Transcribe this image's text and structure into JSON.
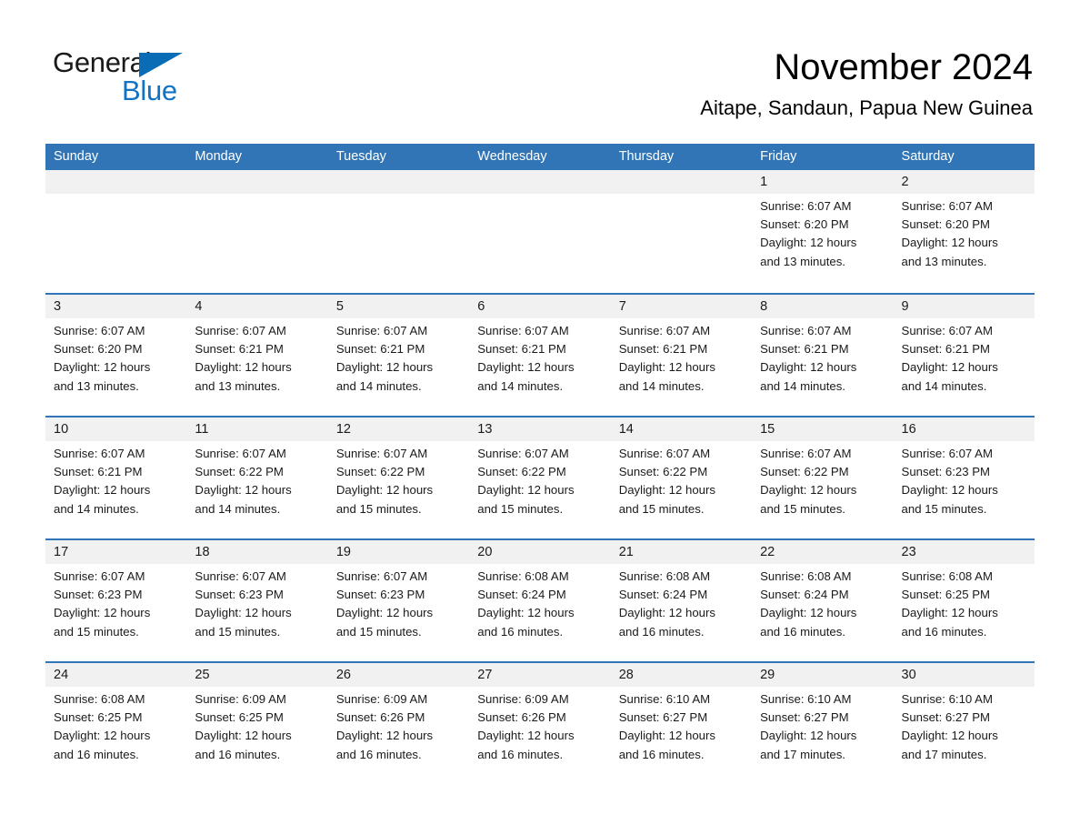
{
  "brand": {
    "word1": "General",
    "word2": "Blue",
    "triangle_color": "#0a6cb4",
    "blue_color": "#1273c4"
  },
  "header": {
    "title": "November 2024",
    "subtitle": "Aitape, Sandaun, Papua New Guinea"
  },
  "theme": {
    "header_blue": "#3275b6",
    "row_band_gray": "#f1f1f1",
    "text_color": "#1a1a1a"
  },
  "weekdays": [
    "Sunday",
    "Monday",
    "Tuesday",
    "Wednesday",
    "Thursday",
    "Friday",
    "Saturday"
  ],
  "weeks": [
    [
      {
        "day": "",
        "info": ""
      },
      {
        "day": "",
        "info": ""
      },
      {
        "day": "",
        "info": ""
      },
      {
        "day": "",
        "info": ""
      },
      {
        "day": "",
        "info": ""
      },
      {
        "day": "1",
        "info": "Sunrise: 6:07 AM\nSunset: 6:20 PM\nDaylight: 12 hours\nand 13 minutes."
      },
      {
        "day": "2",
        "info": "Sunrise: 6:07 AM\nSunset: 6:20 PM\nDaylight: 12 hours\nand 13 minutes."
      }
    ],
    [
      {
        "day": "3",
        "info": "Sunrise: 6:07 AM\nSunset: 6:20 PM\nDaylight: 12 hours\nand 13 minutes."
      },
      {
        "day": "4",
        "info": "Sunrise: 6:07 AM\nSunset: 6:21 PM\nDaylight: 12 hours\nand 13 minutes."
      },
      {
        "day": "5",
        "info": "Sunrise: 6:07 AM\nSunset: 6:21 PM\nDaylight: 12 hours\nand 14 minutes."
      },
      {
        "day": "6",
        "info": "Sunrise: 6:07 AM\nSunset: 6:21 PM\nDaylight: 12 hours\nand 14 minutes."
      },
      {
        "day": "7",
        "info": "Sunrise: 6:07 AM\nSunset: 6:21 PM\nDaylight: 12 hours\nand 14 minutes."
      },
      {
        "day": "8",
        "info": "Sunrise: 6:07 AM\nSunset: 6:21 PM\nDaylight: 12 hours\nand 14 minutes."
      },
      {
        "day": "9",
        "info": "Sunrise: 6:07 AM\nSunset: 6:21 PM\nDaylight: 12 hours\nand 14 minutes."
      }
    ],
    [
      {
        "day": "10",
        "info": "Sunrise: 6:07 AM\nSunset: 6:21 PM\nDaylight: 12 hours\nand 14 minutes."
      },
      {
        "day": "11",
        "info": "Sunrise: 6:07 AM\nSunset: 6:22 PM\nDaylight: 12 hours\nand 14 minutes."
      },
      {
        "day": "12",
        "info": "Sunrise: 6:07 AM\nSunset: 6:22 PM\nDaylight: 12 hours\nand 15 minutes."
      },
      {
        "day": "13",
        "info": "Sunrise: 6:07 AM\nSunset: 6:22 PM\nDaylight: 12 hours\nand 15 minutes."
      },
      {
        "day": "14",
        "info": "Sunrise: 6:07 AM\nSunset: 6:22 PM\nDaylight: 12 hours\nand 15 minutes."
      },
      {
        "day": "15",
        "info": "Sunrise: 6:07 AM\nSunset: 6:22 PM\nDaylight: 12 hours\nand 15 minutes."
      },
      {
        "day": "16",
        "info": "Sunrise: 6:07 AM\nSunset: 6:23 PM\nDaylight: 12 hours\nand 15 minutes."
      }
    ],
    [
      {
        "day": "17",
        "info": "Sunrise: 6:07 AM\nSunset: 6:23 PM\nDaylight: 12 hours\nand 15 minutes."
      },
      {
        "day": "18",
        "info": "Sunrise: 6:07 AM\nSunset: 6:23 PM\nDaylight: 12 hours\nand 15 minutes."
      },
      {
        "day": "19",
        "info": "Sunrise: 6:07 AM\nSunset: 6:23 PM\nDaylight: 12 hours\nand 15 minutes."
      },
      {
        "day": "20",
        "info": "Sunrise: 6:08 AM\nSunset: 6:24 PM\nDaylight: 12 hours\nand 16 minutes."
      },
      {
        "day": "21",
        "info": "Sunrise: 6:08 AM\nSunset: 6:24 PM\nDaylight: 12 hours\nand 16 minutes."
      },
      {
        "day": "22",
        "info": "Sunrise: 6:08 AM\nSunset: 6:24 PM\nDaylight: 12 hours\nand 16 minutes."
      },
      {
        "day": "23",
        "info": "Sunrise: 6:08 AM\nSunset: 6:25 PM\nDaylight: 12 hours\nand 16 minutes."
      }
    ],
    [
      {
        "day": "24",
        "info": "Sunrise: 6:08 AM\nSunset: 6:25 PM\nDaylight: 12 hours\nand 16 minutes."
      },
      {
        "day": "25",
        "info": "Sunrise: 6:09 AM\nSunset: 6:25 PM\nDaylight: 12 hours\nand 16 minutes."
      },
      {
        "day": "26",
        "info": "Sunrise: 6:09 AM\nSunset: 6:26 PM\nDaylight: 12 hours\nand 16 minutes."
      },
      {
        "day": "27",
        "info": "Sunrise: 6:09 AM\nSunset: 6:26 PM\nDaylight: 12 hours\nand 16 minutes."
      },
      {
        "day": "28",
        "info": "Sunrise: 6:10 AM\nSunset: 6:27 PM\nDaylight: 12 hours\nand 16 minutes."
      },
      {
        "day": "29",
        "info": "Sunrise: 6:10 AM\nSunset: 6:27 PM\nDaylight: 12 hours\nand 17 minutes."
      },
      {
        "day": "30",
        "info": "Sunrise: 6:10 AM\nSunset: 6:27 PM\nDaylight: 12 hours\nand 17 minutes."
      }
    ]
  ]
}
